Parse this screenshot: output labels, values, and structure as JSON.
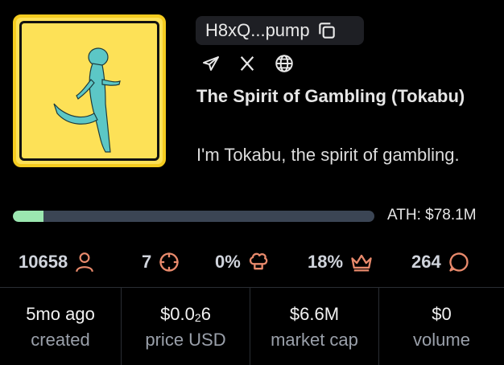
{
  "token": {
    "address": "H8xQ...pump",
    "name": "The Spirit of Gambling (Tokabu)",
    "description": "I'm Tokabu, the spirit of gambling."
  },
  "socials": [
    "telegram-icon",
    "x-icon",
    "globe-icon"
  ],
  "progress": {
    "fraction": 0.085,
    "ath_label": "ATH: $78.1M"
  },
  "stats": [
    {
      "value": "10658",
      "icon": "user-icon",
      "color": "#e98a6c"
    },
    {
      "value": "7",
      "icon": "crosshair-icon",
      "color": "#e98a6c"
    },
    {
      "value": "0%",
      "icon": "chef-hat-icon",
      "color": "#e98a6c"
    },
    {
      "value": "18%",
      "icon": "crown-icon",
      "color": "#e98a6c"
    },
    {
      "value": "264",
      "icon": "chat-bubble-icon",
      "color": "#e98a6c"
    }
  ],
  "metrics": [
    {
      "value": "5mo ago",
      "label": "created"
    },
    {
      "value_prefix": "$0.0",
      "value_sub": "2",
      "value_suffix": "6",
      "label": "price USD"
    },
    {
      "value": "$6.6M",
      "label": "market cap"
    },
    {
      "value": "$0",
      "label": "volume"
    }
  ],
  "colors": {
    "accent": "#e98a6c",
    "progress_fill": "#9be7b0",
    "image_bg": "#fde157",
    "image_border": "#f5cc1f"
  }
}
